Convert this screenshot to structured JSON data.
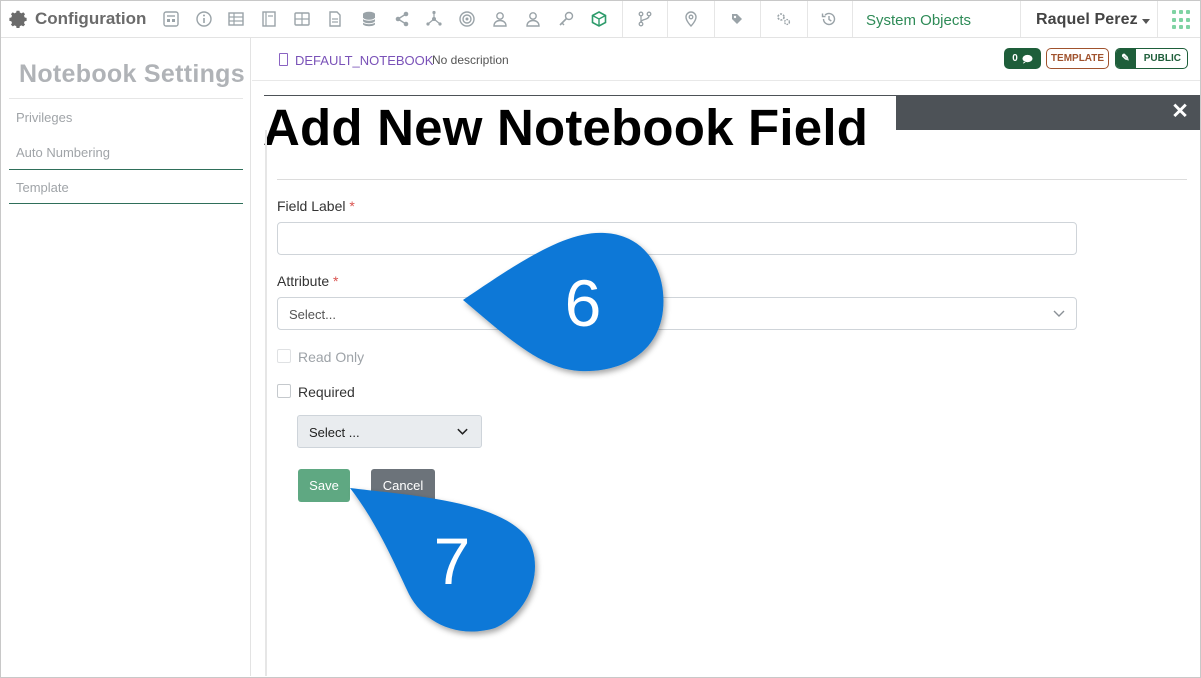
{
  "topbar": {
    "brand_label": "Configuration",
    "system_objects_label": "System Objects",
    "user_name": "Raquel Perez",
    "icons": [
      "gear-icon",
      "calculator-icon",
      "info-icon",
      "table-icon",
      "book-icon",
      "grid-icon",
      "document-icon",
      "database-icon",
      "share-icon",
      "network-icon",
      "badge-icon",
      "users-icon",
      "user-icon",
      "key-icon",
      "cube-icon",
      "branch-icon",
      "location-icon",
      "tag-icon",
      "cogs-icon",
      "history-icon",
      "apps-icon"
    ]
  },
  "sidebar": {
    "title": "Notebook Settings",
    "items": [
      {
        "label": "Privileges"
      },
      {
        "label": "Auto Numbering"
      },
      {
        "label": "Template"
      }
    ]
  },
  "notebook": {
    "name": "DEFAULT_NOTEBOOK",
    "description": "No description",
    "comment_count": "0",
    "template_badge": "TEMPLATE",
    "public_badge": "PUBLIC"
  },
  "modal": {
    "title": "Add New Notebook Field",
    "close_glyph": "✕",
    "field_label_label": "Field Label",
    "field_label_value": "",
    "attribute_label": "Attribute",
    "attribute_placeholder": "Select...",
    "read_only_label": "Read Only",
    "read_only_checked": false,
    "read_only_disabled": true,
    "required_label": "Required",
    "required_checked": false,
    "required_select_value": "Select ...",
    "save_label": "Save",
    "cancel_label": "Cancel",
    "required_marker": "*"
  },
  "callouts": [
    {
      "number": "6",
      "color": "#0a78d7"
    },
    {
      "number": "7",
      "color": "#0a78d7"
    }
  ],
  "colors": {
    "accent_green": "#2e8b57",
    "dark_green": "#1e5e3a",
    "template_brown": "#a0522d",
    "purple": "#7a52b8",
    "callout_blue": "#0a78d7",
    "modal_bar": "#4d5257"
  }
}
